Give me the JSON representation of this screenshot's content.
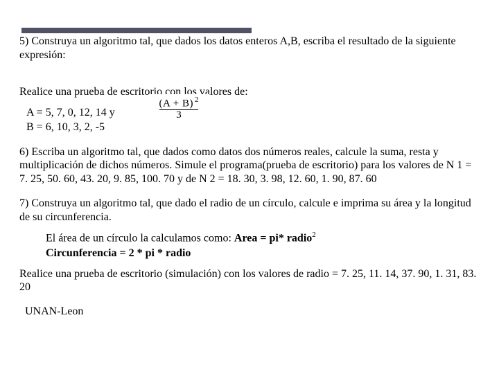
{
  "q5": {
    "prompt": "5) Construya un algoritmo tal, que dados los datos enteros A,B, escriba el resultado de la siguiente expresión:",
    "test_line": "Realice una prueba de escritorio con los valores de:",
    "a_line": "A = 5, 7, 0, 12, 14    y",
    "b_line": "B = 6, 10, 3,  2,  -5",
    "formula_num": "(A + B)",
    "formula_sup": "2",
    "formula_den": "3"
  },
  "q6": {
    "text": "6) Escriba un algoritmo tal, que dados como datos dos números reales, calcule la suma, resta y multiplicación de dichos números. Simule el programa(prueba de escritorio) para los valores de N 1 = 7. 25, 50. 60, 43. 20, 9. 85, 100. 70 y de N 2 = 18. 30, 3. 98, 12. 60, 1. 90, 87. 60"
  },
  "q7": {
    "prompt": "7) Construya un algoritmo tal, que dado el radio de un círculo, calcule e imprima su área y la longitud de su circunferencia.",
    "area_pre": "El área de un círculo la calculamos como: ",
    "area_bold": "Area = pi* radio",
    "area_sup": "2",
    "circ_pre": "",
    "circ_bold": "Circunferencia = 2 * pi * radio",
    "test": "Realice una prueba de escritorio (simulación) con los valores de radio = 7. 25, 11. 14, 37. 90, 1. 31, 83. 20"
  },
  "footer": "UNAN-Leon"
}
